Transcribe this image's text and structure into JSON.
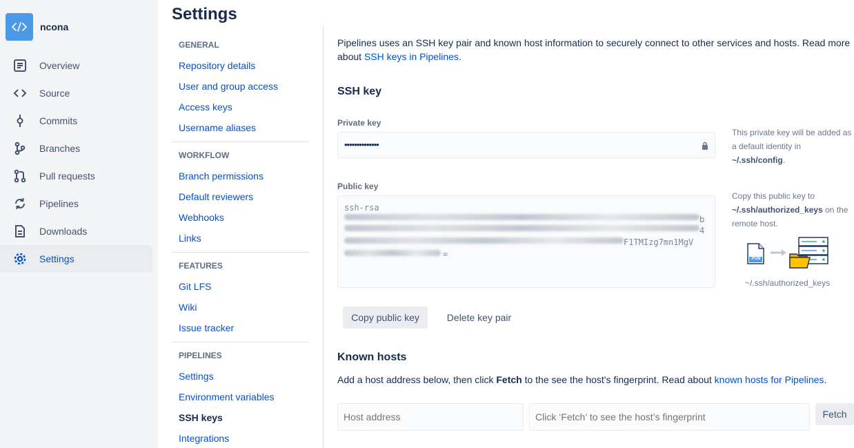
{
  "repo": {
    "name": "ncona",
    "avatar_icon": "code-icon",
    "avatar_color": "#4c9ae8"
  },
  "sidebar": {
    "items": [
      {
        "label": "Overview",
        "icon": "overview-icon"
      },
      {
        "label": "Source",
        "icon": "code-icon"
      },
      {
        "label": "Commits",
        "icon": "commit-icon"
      },
      {
        "label": "Branches",
        "icon": "branch-icon"
      },
      {
        "label": "Pull requests",
        "icon": "pull-request-icon"
      },
      {
        "label": "Pipelines",
        "icon": "pipelines-icon"
      },
      {
        "label": "Downloads",
        "icon": "document-icon"
      },
      {
        "label": "Settings",
        "icon": "gear-icon",
        "active": true
      }
    ]
  },
  "page": {
    "title": "Settings"
  },
  "settings_nav": {
    "general": {
      "heading": "GENERAL",
      "items": [
        "Repository details",
        "User and group access",
        "Access keys",
        "Username aliases"
      ]
    },
    "workflow": {
      "heading": "WORKFLOW",
      "items": [
        "Branch permissions",
        "Default reviewers",
        "Webhooks",
        "Links"
      ]
    },
    "features": {
      "heading": "FEATURES",
      "items": [
        "Git LFS",
        "Wiki",
        "Issue tracker"
      ]
    },
    "pipelines": {
      "heading": "PIPELINES",
      "items": [
        "Settings",
        "Environment variables",
        "SSH keys",
        "Integrations"
      ],
      "active": "SSH keys"
    }
  },
  "content": {
    "intro_text": "Pipelines uses an SSH key pair and known host information to securely connect to other services and hosts. Read more about ",
    "intro_link": "SSH keys in Pipelines",
    "intro_end": ".",
    "ssh_key": {
      "heading": "SSH key",
      "private_label": "Private key",
      "private_value": "••••••••••••••",
      "private_hint_1": "This private key will be added as a default identity in ",
      "private_hint_path": "~/.ssh/config",
      "private_hint_end": ".",
      "public_label": "Public key",
      "public_visible_start": "ssh-rsa",
      "public_visible_frag_1": "b",
      "public_visible_frag_2": "4",
      "public_visible_frag_3": "F1TMIzg7mn1MgV",
      "public_visible_end": "=",
      "public_hint_1": "Copy this public key to ",
      "public_hint_path": "~/.ssh/authorized_keys",
      "public_hint_2": " on the remote host.",
      "illustration_caption": "~/.ssh/authorized_keys",
      "illustration_file_label": ".PUB",
      "copy_button": "Copy public key",
      "delete_button": "Delete key pair"
    },
    "known_hosts": {
      "heading": "Known hosts",
      "desc_1": "Add a host address below, then click ",
      "desc_bold": "Fetch",
      "desc_2": " to the see the host's fingerprint. Read about ",
      "desc_link": "known hosts for Pipelines",
      "desc_end": ".",
      "host_placeholder": "Host address",
      "fingerprint_placeholder": "Click ‘Fetch’ to see the host’s fingerprint",
      "fetch_button": "Fetch"
    }
  },
  "colors": {
    "link": "#0052cc",
    "text": "#172b4d",
    "sidebar_bg": "#f4f5f7",
    "active_bg": "#ebecf0"
  }
}
